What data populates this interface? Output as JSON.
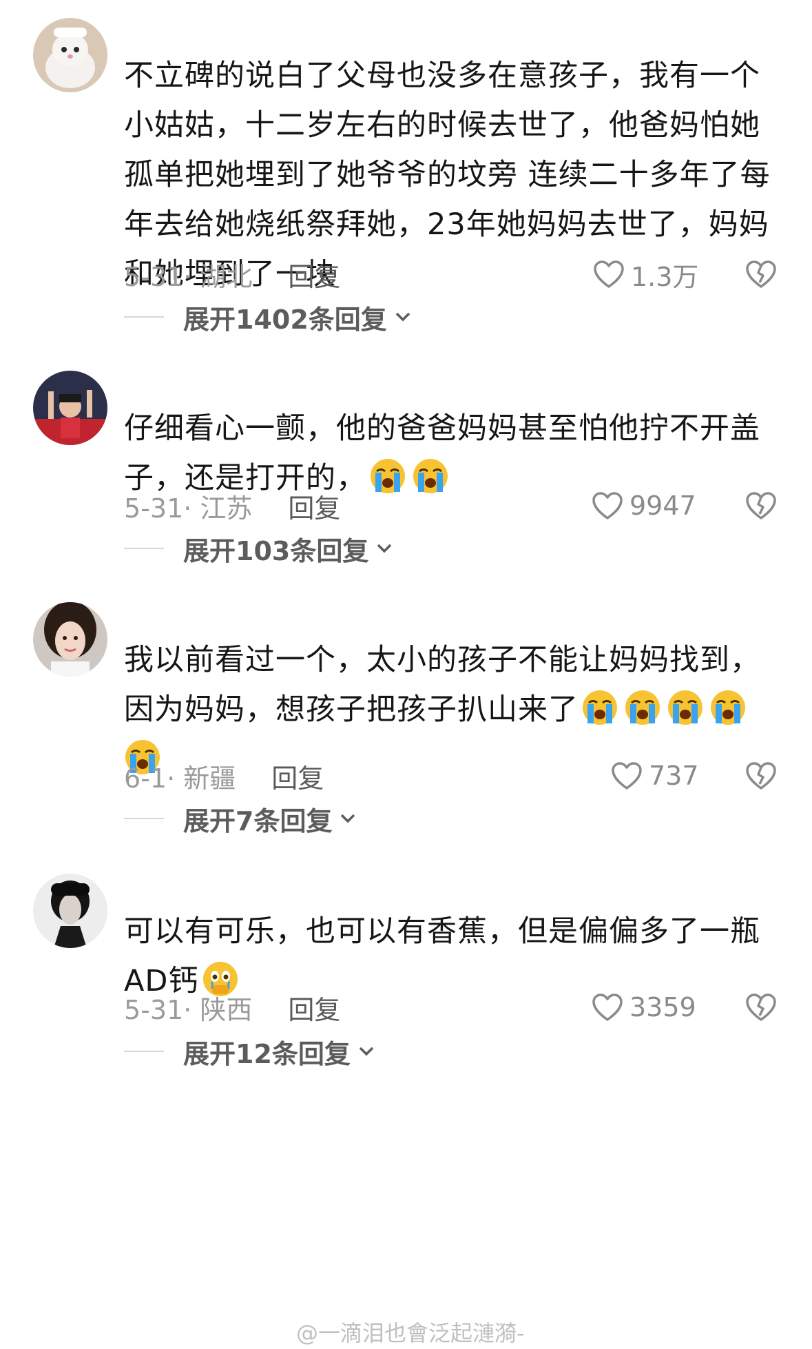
{
  "comments": [
    {
      "text_lines": [
        "不立碑的说白了父母也没多在意孩子，我有一个",
        "小姑姑，十二岁左右的时候去世了，他爸妈怕她",
        "孤单把她埋到了她爷爷的坟旁 连续二十多年了每",
        "年去给她烧纸祭拜她，23年她妈妈去世了，妈妈",
        "和她埋到了一块"
      ],
      "date_location": "5-31· 湖北",
      "reply_label": "回复",
      "likes": "1.3万",
      "expand_label": "展开1402条回复"
    },
    {
      "text_lines": [
        "仔细看心一颤，他的爸爸妈妈甚至怕他拧不开盖",
        "子，还是打开的，"
      ],
      "emoji_count_line2": 2,
      "date_location": "5-31· 江苏",
      "reply_label": "回复",
      "likes": "9947",
      "expand_label": "展开103条回复"
    },
    {
      "text_lines": [
        "我以前看过一个，太小的孩子不能让妈妈找到，",
        "因为妈妈，想孩子把孩子扒山来了"
      ],
      "date_location": "6-1· 新疆",
      "reply_label": "回复",
      "likes": "737",
      "expand_label": "展开7条回复"
    },
    {
      "text_lines": [
        "可以有可乐，也可以有香蕉，但是偏偏多了一瓶",
        "AD钙"
      ],
      "date_location": "5-31· 陕西",
      "reply_label": "回复",
      "likes": "3359",
      "expand_label": "展开12条回复"
    }
  ],
  "watermark": "@一滴泪也會泛起漣漪-",
  "icons": {
    "like": "heart-outline-icon",
    "dislike": "broken-heart-icon",
    "emoji_cry": "loudly-crying-face-icon",
    "emoji_hold_tears": "holding-back-tears-face-icon",
    "chevron": "chevron-down-icon"
  },
  "colors": {
    "meta": "#9a9a9a",
    "reply": "#5a5a5a",
    "text": "#161616"
  }
}
